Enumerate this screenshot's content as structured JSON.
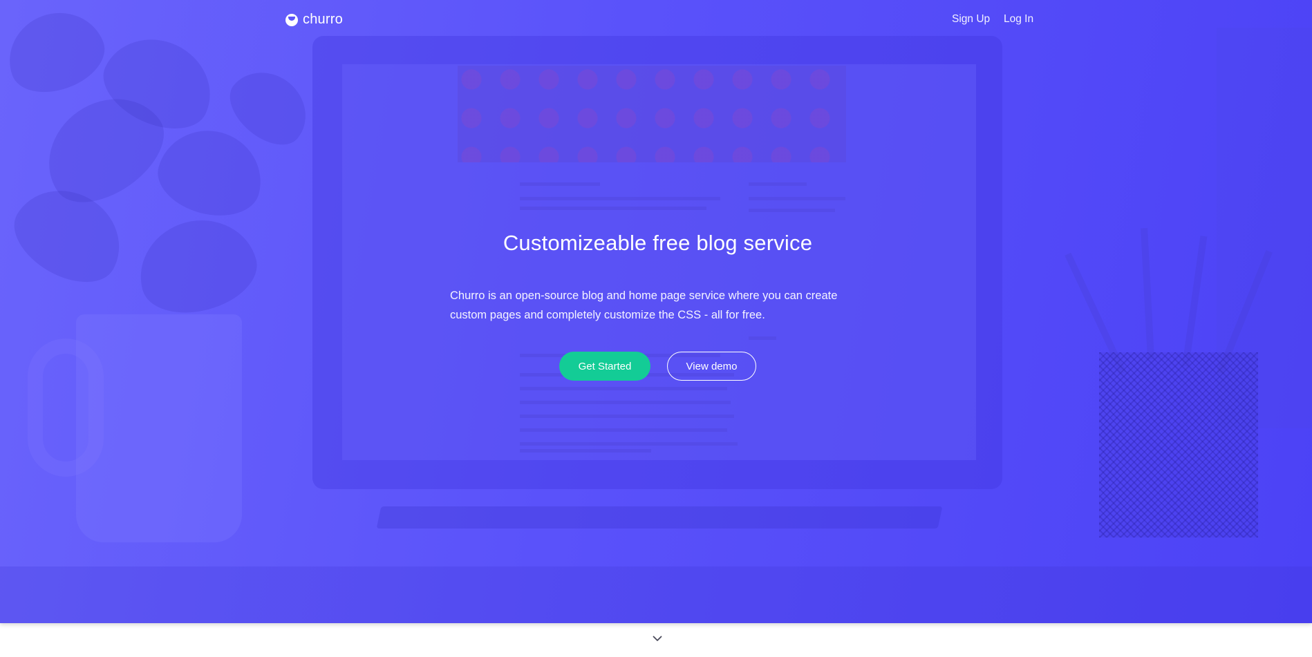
{
  "brand": {
    "name": "churro",
    "logo_icon": "churro-logo-icon"
  },
  "nav": {
    "links": [
      {
        "label": "Sign Up"
      },
      {
        "label": "Log In"
      }
    ]
  },
  "hero": {
    "title": "Customizeable free blog service",
    "description": "Churro is an open-source blog and home page service where you can create custom pages and completely customize the CSS - all for free.",
    "primary_button": "Get Started",
    "secondary_button": "View demo"
  },
  "footer": {
    "scroll_icon": "chevron-down-icon"
  },
  "colors": {
    "hero_gradient_start": "#6a64fb",
    "hero_gradient_end": "#4c42f6",
    "primary_button": "#13cc96",
    "text": "#ffffff",
    "page_background": "#ffffff"
  }
}
